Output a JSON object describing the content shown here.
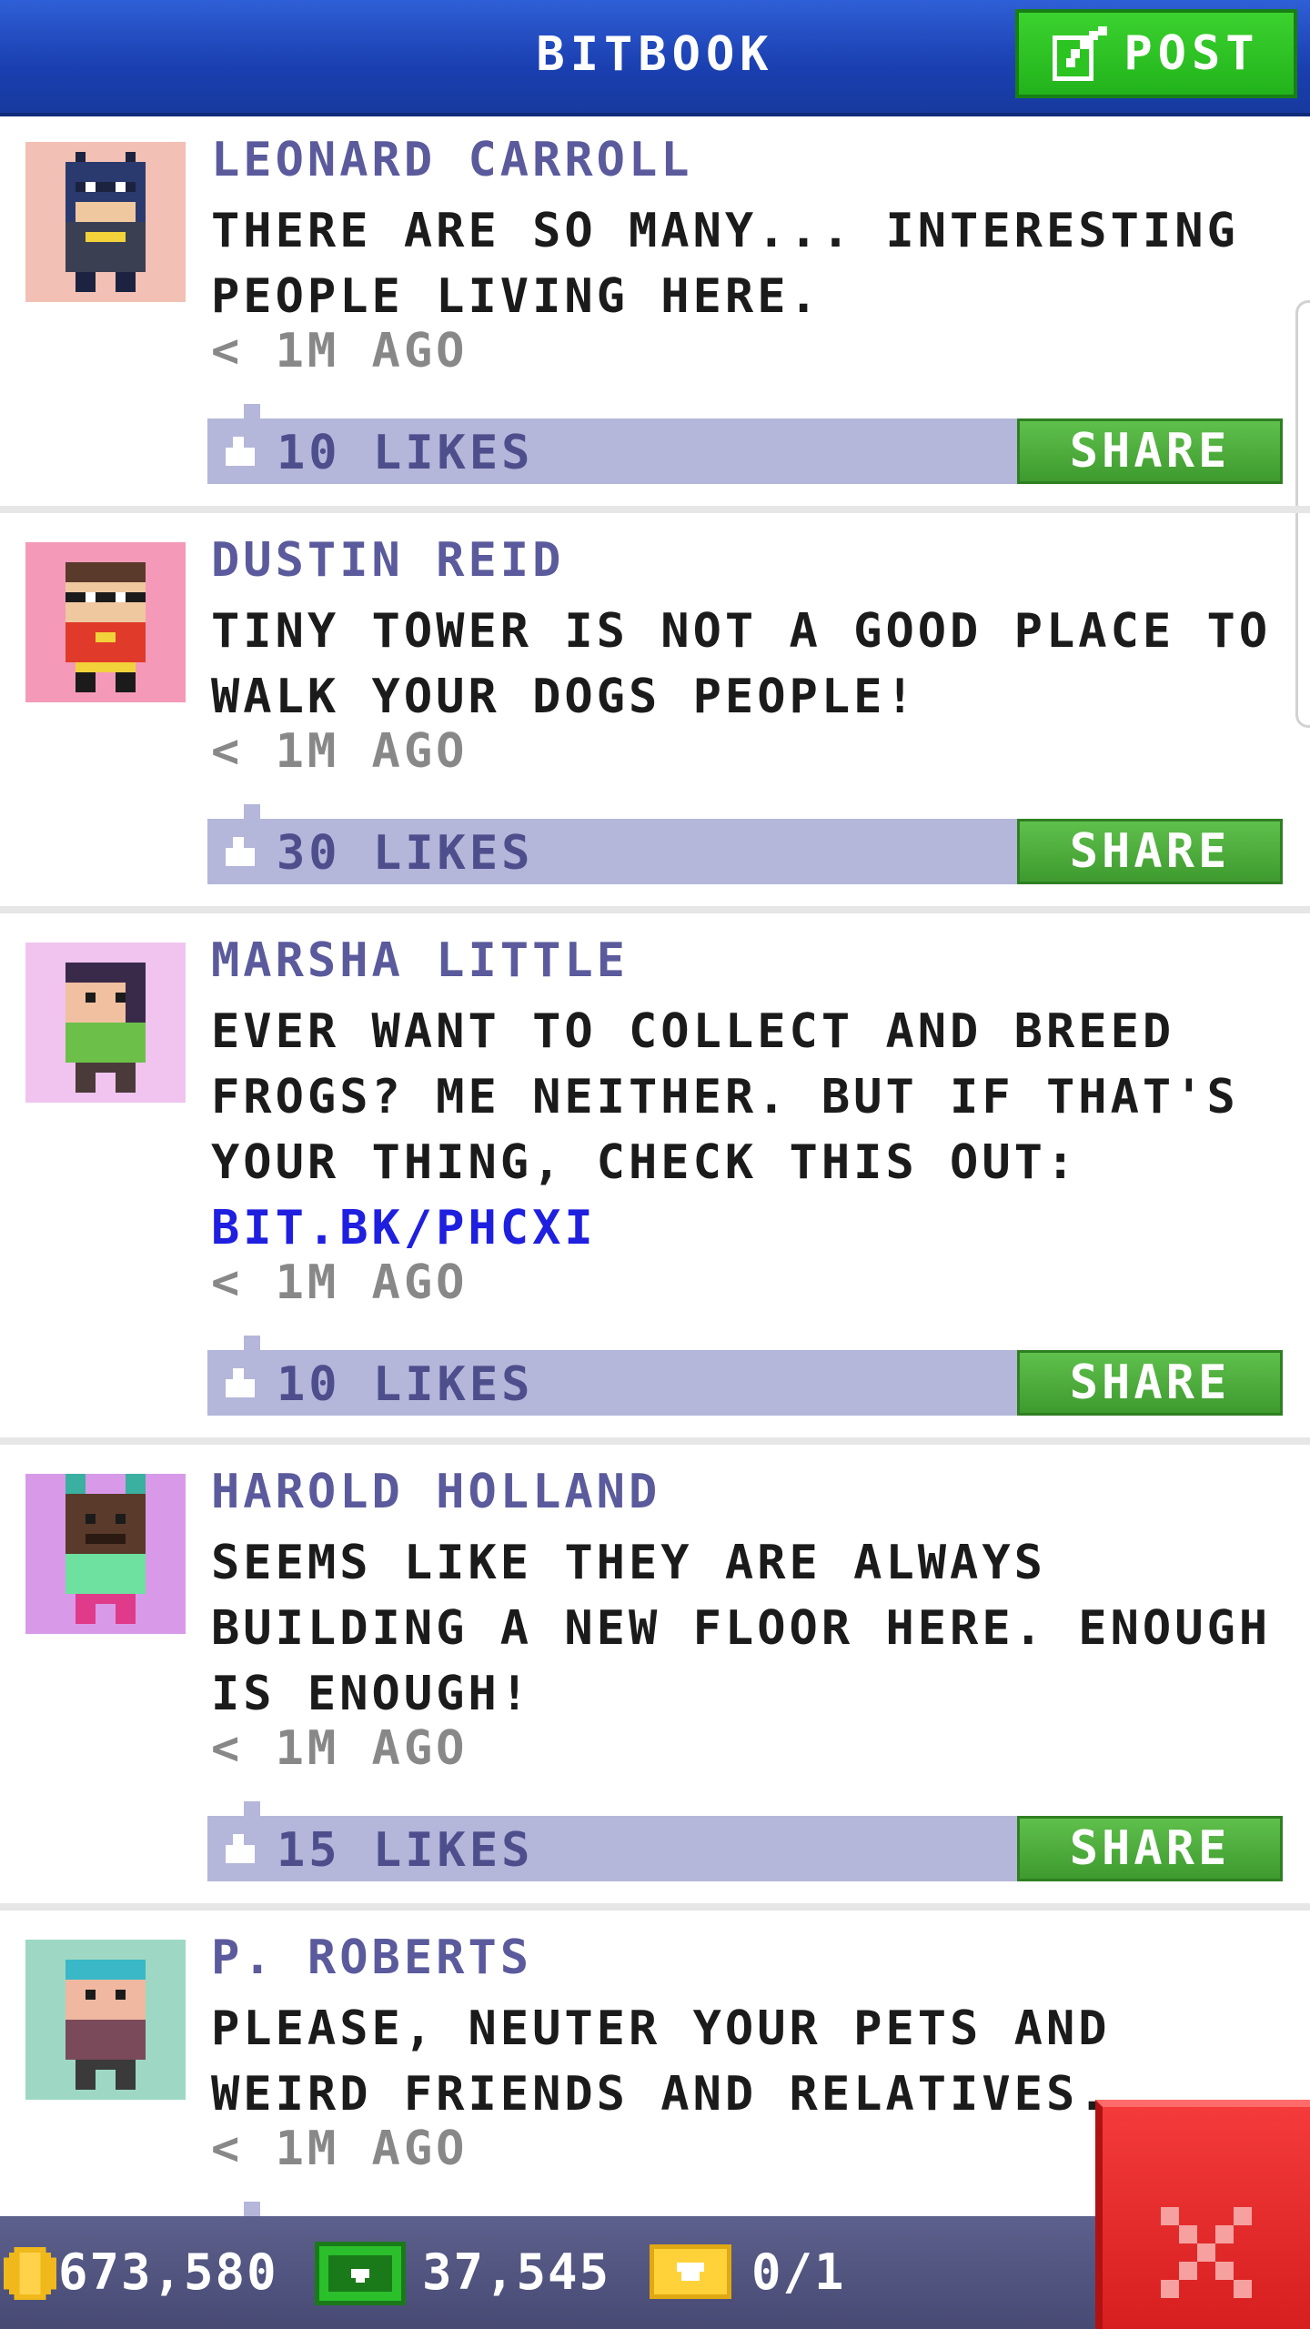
{
  "header": {
    "title": "BITBOOK",
    "post_label": "POST"
  },
  "posts": [
    {
      "name": "LEONARD CARROLL",
      "message": "THERE ARE SO MANY... INTERESTING PEOPLE LIVING HERE.",
      "link": "",
      "time": "< 1M AGO",
      "likes": "10 LIKES",
      "share_label": "SHARE",
      "avatar_bg": "#f2c0b4"
    },
    {
      "name": "DUSTIN REID",
      "message": "TINY TOWER IS NOT A GOOD PLACE TO WALK YOUR DOGS PEOPLE!",
      "link": "",
      "time": "< 1M AGO",
      "likes": "30 LIKES",
      "share_label": "SHARE",
      "avatar_bg": "#f49ab8"
    },
    {
      "name": "MARSHA LITTLE",
      "message": "EVER WANT TO COLLECT AND BREED FROGS? ME NEITHER. BUT IF THAT'S YOUR THING, CHECK THIS OUT:",
      "link": "BIT.BK/PHCXI",
      "time": "< 1M AGO",
      "likes": "10 LIKES",
      "share_label": "SHARE",
      "avatar_bg": "#f0c4ee"
    },
    {
      "name": "HAROLD HOLLAND",
      "message": "SEEMS LIKE THEY ARE ALWAYS BUILDING A NEW FLOOR HERE. ENOUGH IS ENOUGH!",
      "link": "",
      "time": "< 1M AGO",
      "likes": "15 LIKES",
      "share_label": "SHARE",
      "avatar_bg": "#d89ae8"
    },
    {
      "name": "P. ROBERTS",
      "message": "PLEASE, NEUTER YOUR PETS AND WEIRD FRIENDS AND RELATIVES.",
      "link": "",
      "time": "< 1M AGO",
      "likes": "",
      "share_label": "",
      "avatar_bg": "#9ed8c4"
    }
  ],
  "status_bar": {
    "coins": "673,580",
    "bux": "37,545",
    "tickets": "0/1"
  },
  "colors": {
    "header": "#1a3fb0",
    "post_button": "#22b31b",
    "like_bar": "#b4b6da",
    "share": "#3e9a2e",
    "close": "#d71f1f"
  },
  "icons": [
    "edit-icon",
    "like-icon",
    "coin-icon",
    "bux-icon",
    "ticket-icon",
    "close-icon"
  ]
}
